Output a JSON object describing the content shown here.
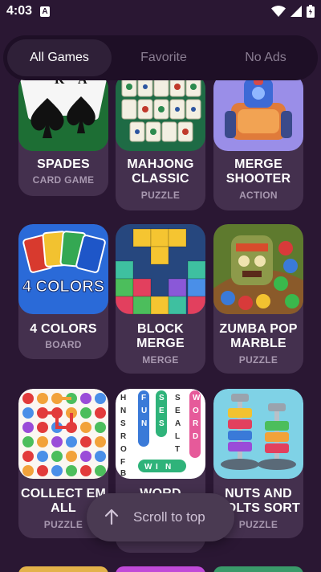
{
  "status": {
    "time": "4:03",
    "notification_glyph": "A"
  },
  "tabs": [
    {
      "label": "All Games",
      "active": true
    },
    {
      "label": "Favorite",
      "active": false
    },
    {
      "label": "No Ads",
      "active": false
    }
  ],
  "games": [
    {
      "title": "SPADES",
      "category": "CARD GAME",
      "thumb": "spades"
    },
    {
      "title": "MAHJONG CLASSIC",
      "category": "PUZZLE",
      "thumb": "mahjong"
    },
    {
      "title": "MERGE SHOOTER",
      "category": "ACTION",
      "thumb": "shooter"
    },
    {
      "title": "4 COLORS",
      "category": "BOARD",
      "thumb": "colors",
      "thumb_text": "4 COLORS"
    },
    {
      "title": "BLOCK MERGE",
      "category": "MERGE",
      "thumb": "block"
    },
    {
      "title": "ZUMBA POP MARBLE",
      "category": "PUZZLE",
      "thumb": "zumba"
    },
    {
      "title": "COLLECT EM ALL",
      "category": "PUZZLE",
      "thumb": "collect"
    },
    {
      "title": "WORD",
      "category": "",
      "thumb": "word",
      "thumb_text": [
        "F",
        "U",
        "N",
        "S",
        "E",
        "S",
        "T",
        "W",
        "I",
        "N"
      ]
    },
    {
      "title": "NUTS AND BOLTS SORT",
      "category": "PUZZLE",
      "thumb": "nuts"
    }
  ],
  "scroll_to_top": {
    "label": "Scroll to top"
  },
  "colors": {
    "background": "#2a1733",
    "card": "#44304e",
    "tab_bar": "#1e0f26",
    "tab_active": "#2f2038",
    "muted_text": "#a898b0"
  }
}
